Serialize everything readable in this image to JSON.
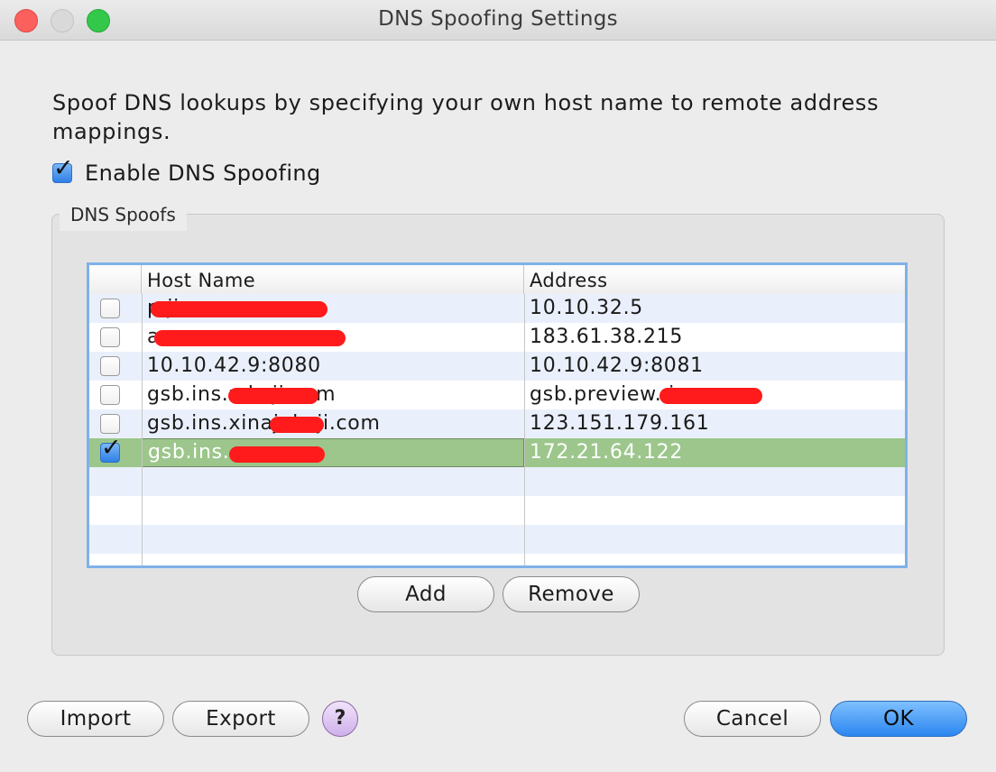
{
  "window": {
    "title": "DNS Spoofing Settings"
  },
  "description": "Spoof DNS lookups by specifying your own host name to remote address mappings.",
  "enable": {
    "label": "Enable DNS Spoofing",
    "checked": true
  },
  "group": {
    "legend": "DNS Spoofs"
  },
  "table": {
    "columns": [
      "",
      "Host Name",
      "Address"
    ],
    "rows": [
      {
        "checked": false,
        "host": "p                 ji.com",
        "address": "10.10.32.5"
      },
      {
        "checked": false,
        "host": "a                       n.cn",
        "address": "183.61.38.215"
      },
      {
        "checked": false,
        "host": "10.10.42.9:8080",
        "address": "10.10.42.9:8081"
      },
      {
        "checked": false,
        "host": "gsb.ins.x           keji.com",
        "address": "gsb.preview.              i.com"
      },
      {
        "checked": false,
        "host": "gsb.ins.xinajukeji.com",
        "address": "123.151.179.161"
      },
      {
        "checked": true,
        "host": "gsb.ins.                   .com",
        "address": "172.21.64.122",
        "selected": true
      }
    ]
  },
  "buttons": {
    "add": "Add",
    "remove": "Remove",
    "import": "Import",
    "export": "Export",
    "help": "?",
    "cancel": "Cancel",
    "ok": "OK"
  },
  "colors": {
    "selection": "#9cc68b",
    "focus_ring": "#7fb1e8",
    "redaction": "#ff1b1b",
    "ok_button": "#2b86f0"
  }
}
